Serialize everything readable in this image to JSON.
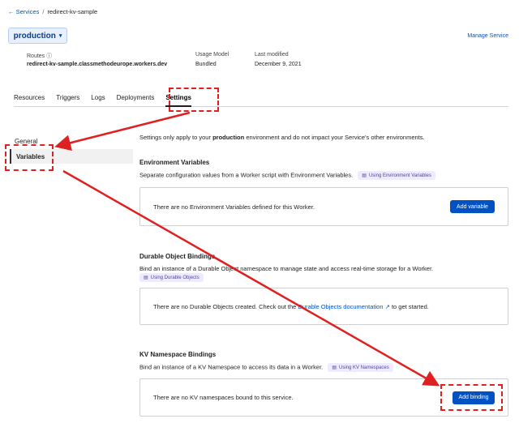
{
  "breadcrumb": {
    "back_label": "← Services",
    "sep": "/",
    "current": "redirect-kv-sample"
  },
  "env_selector": {
    "label": "production",
    "caret": "▾"
  },
  "manage_service": "Manage Service",
  "meta": {
    "routes_label": "Routes ⓘ",
    "routes_value": "redirect-kv-sample.classmethodeurope.workers.dev",
    "usage_label": "Usage Model",
    "usage_value": "Bundled",
    "modified_label": "Last modified",
    "modified_value": "December 9, 2021"
  },
  "tabs": [
    "Resources",
    "Triggers",
    "Logs",
    "Deployments",
    "Settings"
  ],
  "sidebar": {
    "items": [
      "General",
      "Variables"
    ]
  },
  "intro": {
    "pre": "Settings only apply to your ",
    "env": "production",
    "post": " environment and do not impact your Service's other environments."
  },
  "env_vars": {
    "title": "Environment Variables",
    "desc": "Separate configuration values from a Worker script with Environment Variables.",
    "pill": "Using Environment Variables",
    "empty": "There are no Environment Variables defined for this Worker.",
    "button": "Add variable"
  },
  "durable": {
    "title": "Durable Object Bindings",
    "desc": "Bind an instance of a Durable Object namespace to manage state and access real-time storage for a Worker.",
    "pill": "Using Durable Objects",
    "empty_pre": "There are no Durable Objects created. Check out the ",
    "empty_link": "Durable Objects documentation",
    "empty_post": " to get started."
  },
  "kv": {
    "title": "KV Namespace Bindings",
    "desc": "Bind an instance of a KV Namespace to access its data in a Worker.",
    "pill": "Using KV Namespaces",
    "empty": "There are no KV namespaces bound to this service.",
    "button": "Add binding"
  },
  "colors": {
    "accent": "#0051c3",
    "annotation": "#e02020"
  }
}
